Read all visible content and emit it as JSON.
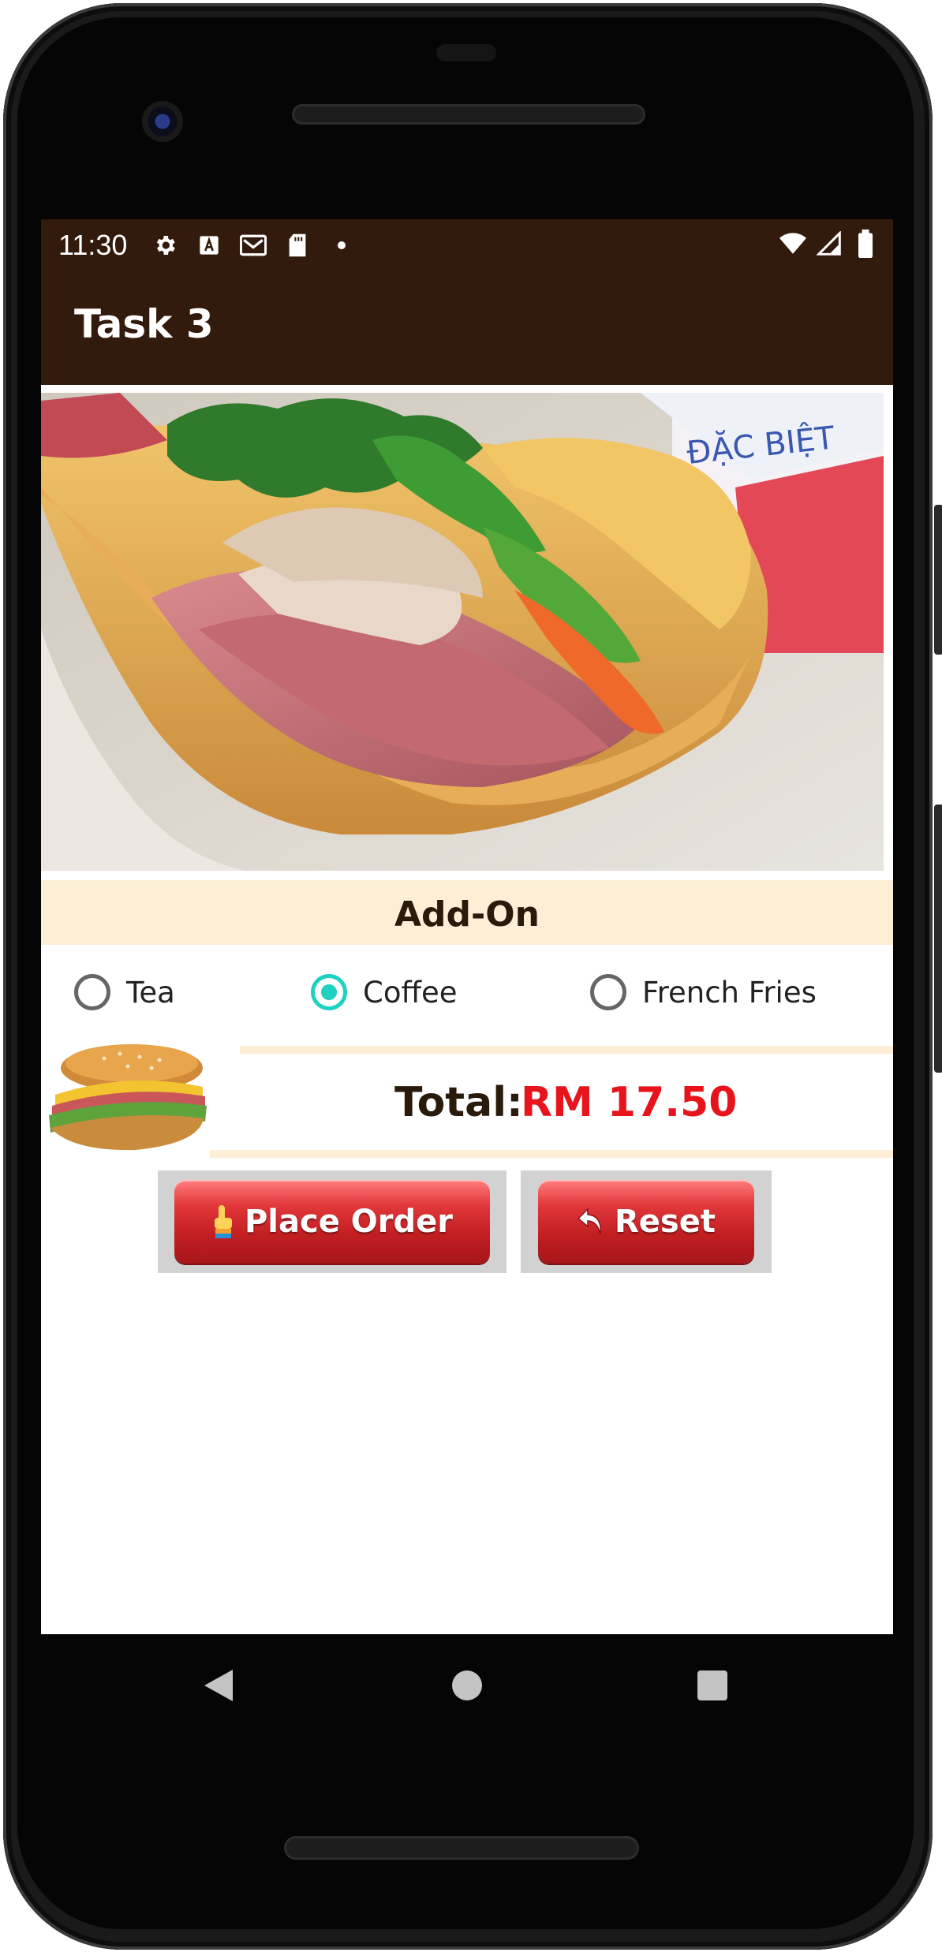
{
  "status_bar": {
    "time": "11:30",
    "left_icons": [
      "settings-icon",
      "font-a-icon",
      "gmail-icon",
      "sd-card-icon",
      "dot-icon"
    ],
    "right_icons": [
      "wifi-icon",
      "signal-icon",
      "battery-icon"
    ]
  },
  "app_bar": {
    "title": "Task 3",
    "background_color": "#321a0c"
  },
  "hero": {
    "image_description_icon": "sandwich-photo"
  },
  "addon": {
    "heading": "Add-On",
    "options": [
      {
        "label": "Tea",
        "selected": false
      },
      {
        "label": "Coffee",
        "selected": true
      },
      {
        "label": "French Fries",
        "selected": false
      }
    ],
    "accent_color": "#1fd1c1"
  },
  "total": {
    "label": "Total:",
    "value": "RM 17.50",
    "value_color": "#e8141c"
  },
  "buttons": {
    "place_order": "Place Order",
    "reset": "Reset"
  },
  "nav": {
    "icons": [
      "back-icon",
      "home-icon",
      "recents-icon"
    ]
  }
}
